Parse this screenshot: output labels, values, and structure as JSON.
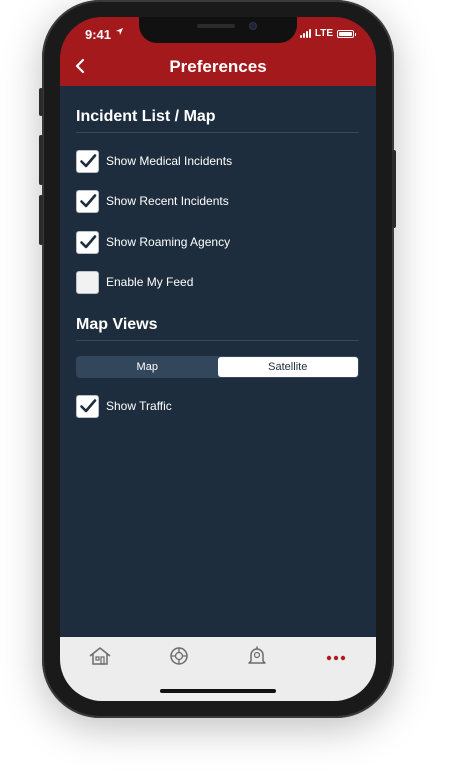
{
  "status_bar": {
    "time": "9:41",
    "carrier": "LTE"
  },
  "header": {
    "title": "Preferences",
    "back_icon": "chevron-left-icon"
  },
  "sections": {
    "incident": {
      "title": "Incident List / Map",
      "options": [
        {
          "label": "Show Medical Incidents",
          "checked": true
        },
        {
          "label": "Show Recent Incidents",
          "checked": true
        },
        {
          "label": "Show Roaming Agency",
          "checked": true
        },
        {
          "label": "Enable My Feed",
          "checked": false
        }
      ]
    },
    "map_views": {
      "title": "Map Views",
      "segments": [
        "Map",
        "Satellite"
      ],
      "selected": "Satellite",
      "traffic": {
        "label": "Show Traffic",
        "checked": true
      }
    }
  },
  "tabbar": {
    "items": [
      {
        "icon": "home-icon"
      },
      {
        "icon": "fire-department-icon"
      },
      {
        "icon": "alert-bell-icon"
      },
      {
        "icon": "more-icon",
        "active": true
      }
    ]
  },
  "colors": {
    "accent": "#a4191b",
    "background": "#1e2d3d",
    "tabbar": "#ededed"
  }
}
